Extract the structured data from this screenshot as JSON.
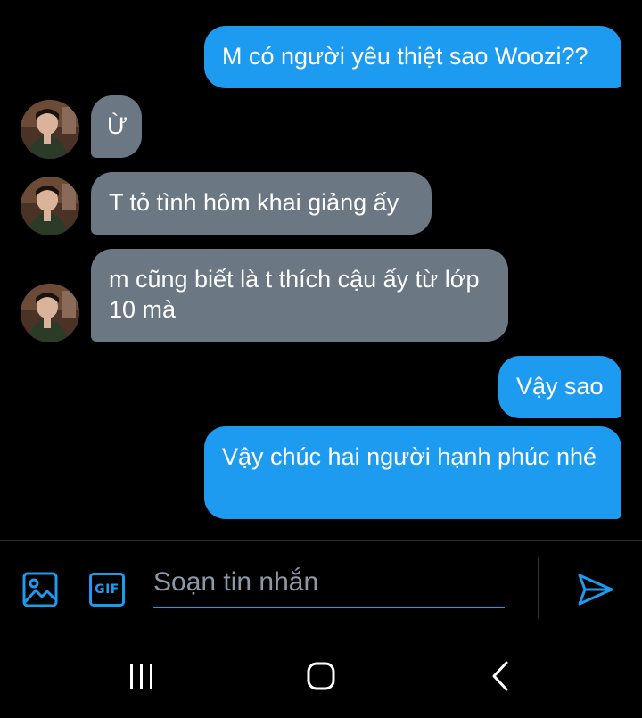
{
  "messages": [
    {
      "side": "sent",
      "text": "M có người yêu thiệt sao Woozi??"
    },
    {
      "side": "received",
      "text": "Ừ"
    },
    {
      "side": "received",
      "text": "T tỏ tình hôm khai giảng ấy"
    },
    {
      "side": "received",
      "text": "m cũng biết là t thích cậu ấy từ lớp 10 mà"
    },
    {
      "side": "sent",
      "text": "Vậy sao"
    },
    {
      "side": "sent",
      "text": "Vậy chúc hai người hạnh phúc nhé"
    }
  ],
  "composer": {
    "placeholder": "Soạn tin nhắn",
    "gif_label": "GIF",
    "icons": [
      "image-icon",
      "gif-icon",
      "send-icon"
    ]
  },
  "navbar": {
    "icons": [
      "recent-apps-icon",
      "home-icon",
      "back-icon"
    ]
  },
  "colors": {
    "background": "#000000",
    "sent_bubble": "#1d9bf0",
    "received_bubble": "#6b7884",
    "accent": "#1d9bf0",
    "placeholder": "#8b98a5"
  }
}
